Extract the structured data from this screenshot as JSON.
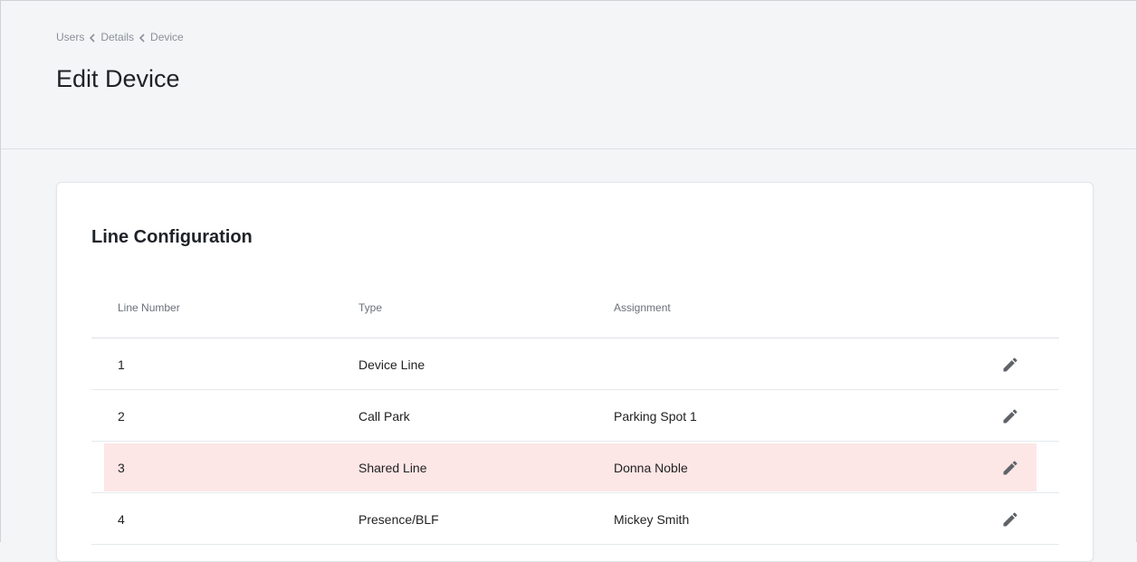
{
  "breadcrumb": {
    "items": [
      "Users",
      "Details",
      "Device"
    ]
  },
  "page": {
    "title": "Edit Device"
  },
  "line_config": {
    "title": "Line Configuration",
    "columns": {
      "line_number": "Line Number",
      "type": "Type",
      "assignment": "Assignment"
    },
    "rows": [
      {
        "line_number": "1",
        "type": "Device Line",
        "assignment": "",
        "highlighted": false,
        "action_icon": "pencil-icon"
      },
      {
        "line_number": "2",
        "type": "Call Park",
        "assignment": "Parking Spot 1",
        "highlighted": false,
        "action_icon": "pencil-icon"
      },
      {
        "line_number": "3",
        "type": "Shared Line",
        "assignment": "Donna Noble",
        "highlighted": true,
        "action_icon": "pencil-icon"
      },
      {
        "line_number": "4",
        "type": "Presence/BLF",
        "assignment": "Mickey Smith",
        "highlighted": false,
        "action_icon": "pencil-icon"
      }
    ]
  },
  "colors": {
    "background": "#f3f5f7",
    "card": "#ffffff",
    "highlight_row": "#fde6e6",
    "icon": "#5f6368"
  }
}
